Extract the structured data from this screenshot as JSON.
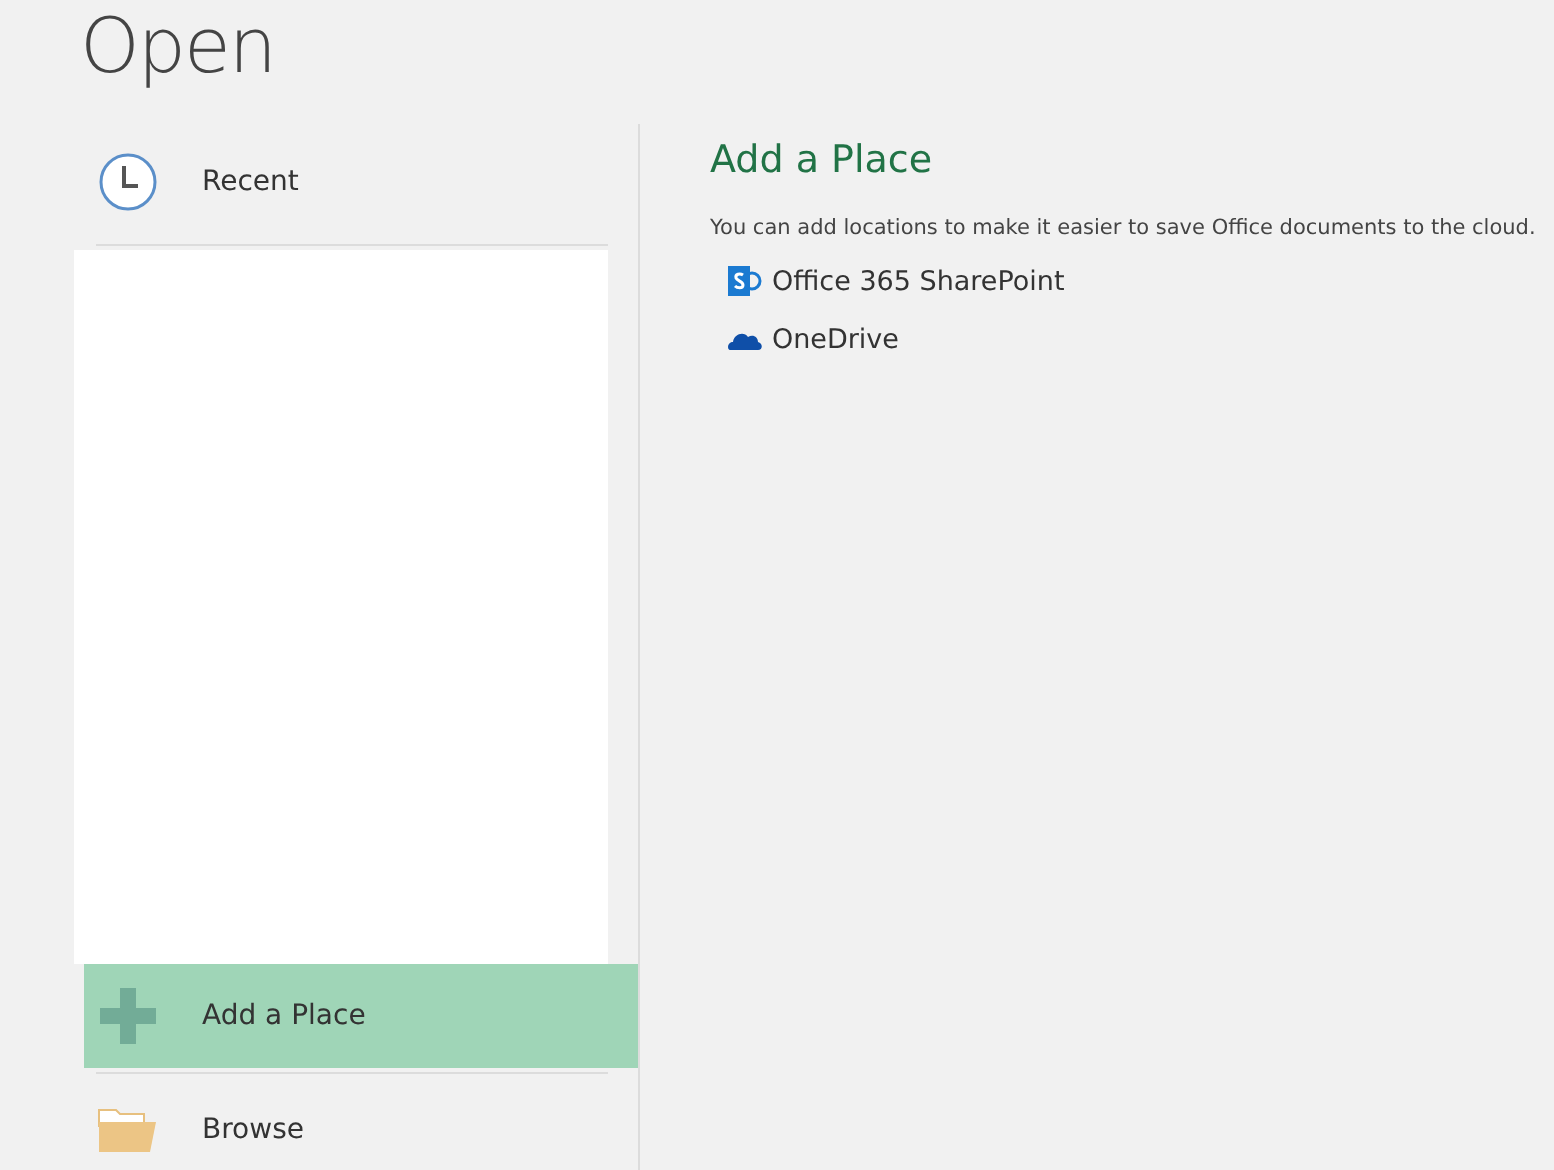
{
  "title": "Open",
  "nav": [
    {
      "label": "Recent",
      "kind": "recent",
      "selected": false
    },
    {
      "label": "Add a Place",
      "kind": "add",
      "selected": true
    },
    {
      "label": "Browse",
      "kind": "browse",
      "selected": false
    }
  ],
  "panel": {
    "heading": "Add a Place",
    "description": "You can add locations to make it easier to save Office documents to the cloud.",
    "places": [
      {
        "label": "Office 365 SharePoint",
        "kind": "sharepoint"
      },
      {
        "label": "OneDrive",
        "kind": "onedrive"
      }
    ]
  }
}
